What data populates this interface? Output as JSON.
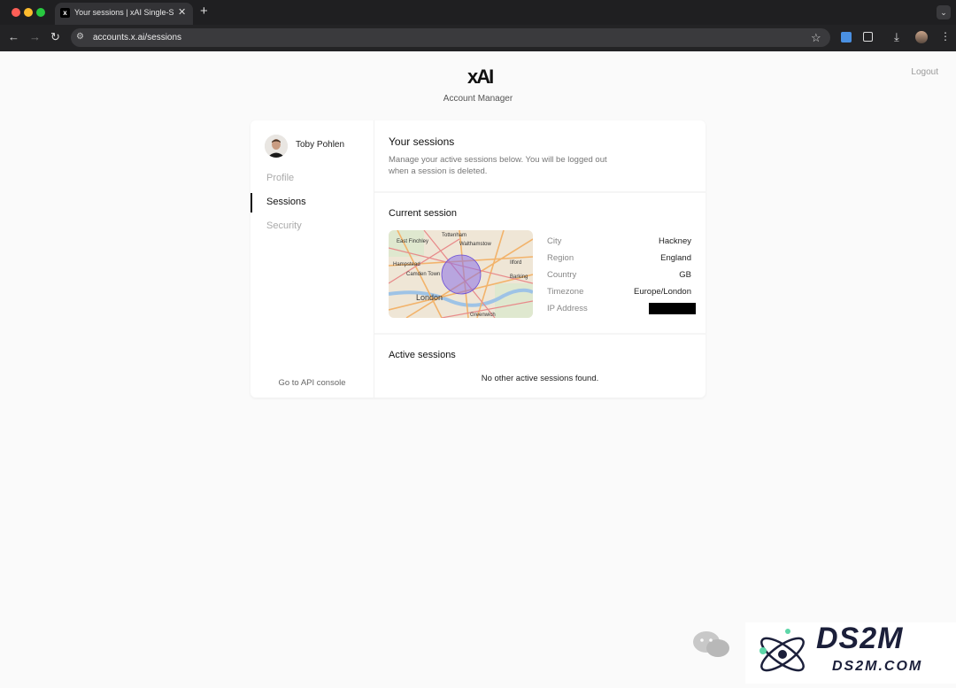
{
  "browser": {
    "tab_title": "Your sessions | xAI Single-Sign-On",
    "tab_favicon": "xAI",
    "url": "accounts.x.ai/sessions"
  },
  "header": {
    "logo_text": "xAI",
    "subtitle": "Account Manager",
    "logout_label": "Logout"
  },
  "sidebar": {
    "user_name": "Toby Pohlen",
    "items": [
      {
        "label": "Profile",
        "active": false
      },
      {
        "label": "Sessions",
        "active": true
      },
      {
        "label": "Security",
        "active": false
      }
    ],
    "console_link": "Go to API console"
  },
  "sessions": {
    "title": "Your sessions",
    "description": "Manage your active sessions below. You will be logged out when a session is deleted."
  },
  "current_session": {
    "title": "Current session",
    "map_labels": [
      "Tottenham",
      "East Finchley",
      "Walthamstow",
      "Hampstead",
      "Ilford",
      "Camden Town",
      "Barking",
      "London",
      "Greenwich"
    ],
    "fields": [
      {
        "label": "City",
        "value": "Hackney"
      },
      {
        "label": "Region",
        "value": "England"
      },
      {
        "label": "Country",
        "value": "GB"
      },
      {
        "label": "Timezone",
        "value": "Europe/London"
      },
      {
        "label": "IP Address",
        "value": ""
      }
    ]
  },
  "active_sessions": {
    "title": "Active sessions",
    "empty_message": "No other active sessions found."
  },
  "watermark": {
    "brand": "DS2M",
    "domain": "DS2M.COM"
  },
  "colors": {
    "page_bg": "#fafafa",
    "chrome_bg": "#232325",
    "active_indicator": "#111111",
    "map_circle": "#8a6fe8"
  }
}
